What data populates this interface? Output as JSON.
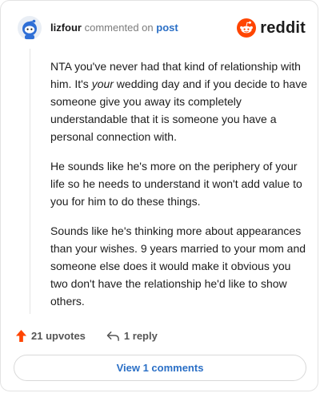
{
  "header": {
    "username": "lizfour",
    "action_text": "commented on",
    "post_link": "post",
    "brand": "reddit",
    "brand_color": "#ff4500"
  },
  "comment": {
    "paragraphs": [
      {
        "before": "NTA you've never had that kind of relationship with him. It's ",
        "emphasis": "your",
        "after": " wedding day and if you decide to have someone give you away its completely understandable that it is someone you have a personal connection with."
      },
      {
        "text": "He sounds like he's more on the periphery of your life so he needs to understand it won't add value to you for him to do these things."
      },
      {
        "text": "Sounds like he's thinking more about appearances than your wishes. 9 years married to your mom and someone else does it would make it obvious you two don't have the relationship he'd like to show others."
      }
    ]
  },
  "actions": {
    "upvotes_label": "21 upvotes",
    "upvote_icon": "upvote-arrow-icon",
    "upvote_color": "#ff4500",
    "reply_label": "1 reply",
    "reply_icon": "reply-arrow-icon"
  },
  "footer": {
    "view_comments_label": "View 1 comments",
    "link_color": "#2a6fc6"
  }
}
